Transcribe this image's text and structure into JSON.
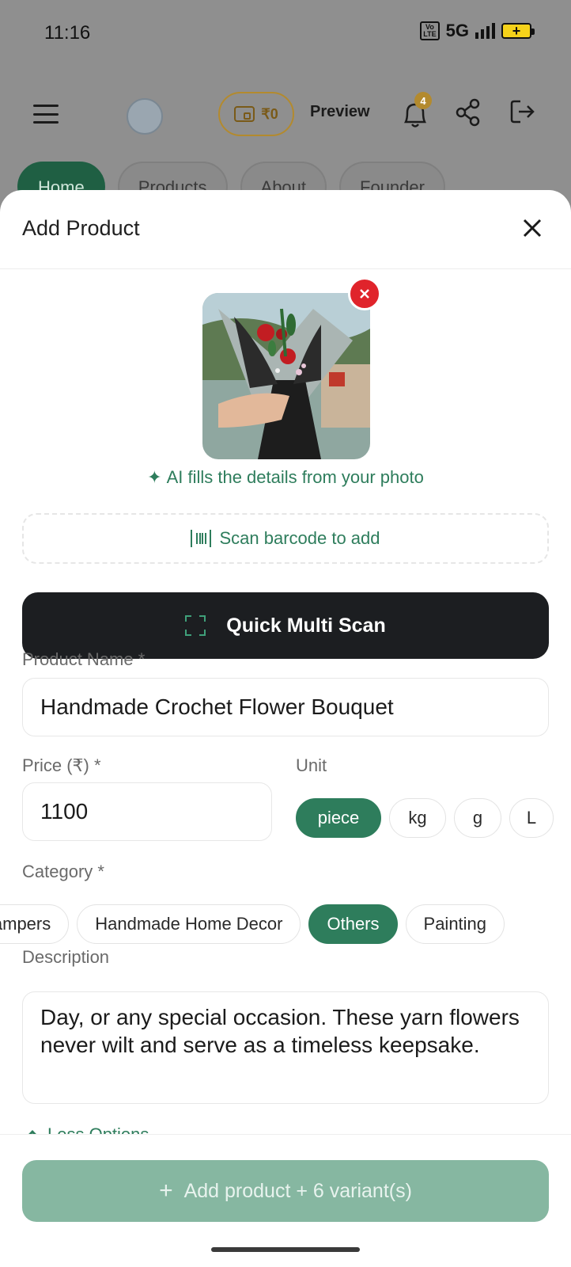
{
  "status_bar": {
    "time": "11:16",
    "volte": "Vo\nLTE",
    "network": "5G",
    "battery_symbol": "+"
  },
  "app_bar": {
    "wallet_amount": "₹0",
    "preview_label": "Preview",
    "notification_count": "4"
  },
  "background_tabs": [
    "Home",
    "Products",
    "About",
    "Founder"
  ],
  "sheet": {
    "title": "Add Product",
    "ai_hint": "AI fills the details from your photo",
    "barcode_label": "Scan barcode to add",
    "quick_scan_label": "Quick Multi Scan",
    "product_name": {
      "label": "Product Name *",
      "value": "Handmade Crochet Flower Bouquet"
    },
    "price": {
      "label": "Price (₹) *",
      "value": "1100"
    },
    "unit": {
      "label": "Unit",
      "options": [
        "piece",
        "kg",
        "g",
        "L"
      ],
      "selected": "piece"
    },
    "category": {
      "label": "Category *",
      "options": [
        "Hampers",
        "Handmade Home Decor",
        "Others",
        "Painting"
      ],
      "selected": "Others"
    },
    "description": {
      "label": "Description",
      "value": "Day, or any special occasion. These yarn flowers never wilt and serve as a timeless keepsake."
    },
    "less_options_label": "Less Options",
    "submit_label": "Add product + 6 variant(s)"
  },
  "colors": {
    "accent": "#2e7d5c",
    "dark_button": "#1c1e21",
    "remove_red": "#e0242b",
    "disabled_submit": "#86b7a1"
  }
}
